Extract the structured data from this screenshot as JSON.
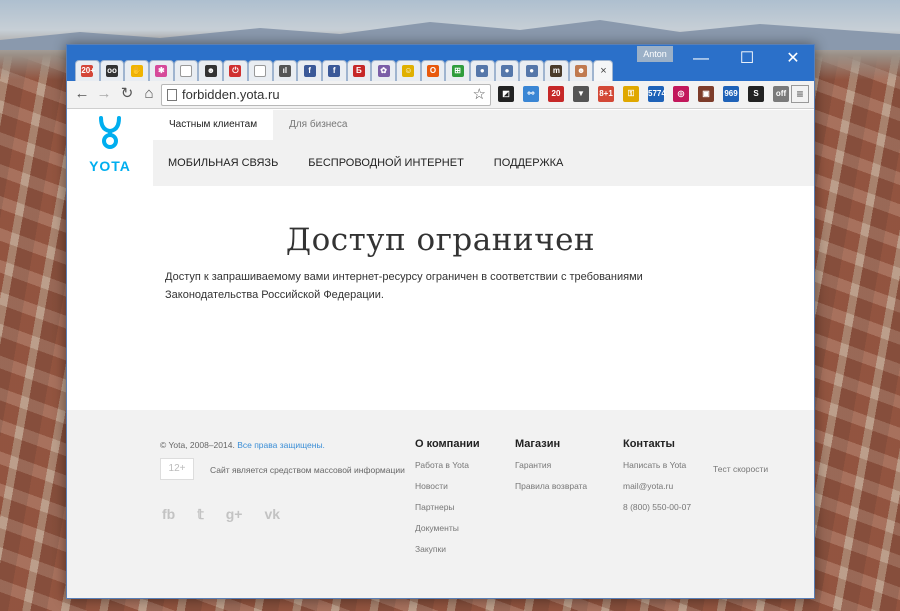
{
  "browser": {
    "profile_name": "Anton",
    "address": "forbidden.yota.ru",
    "window_controls": {
      "minimize": "—",
      "maximize": "☐",
      "close": "✕"
    },
    "active_tab_close": "×",
    "tab_favicons": [
      {
        "icon": "gmail-count-icon",
        "text": "20+",
        "color": "#d44638"
      },
      {
        "icon": "tripadvisor-icon",
        "text": "oo",
        "color": "#333333"
      },
      {
        "icon": "yellow-hand-icon",
        "text": "✋",
        "color": "#f0b400"
      },
      {
        "icon": "colorful-pinwheel-icon",
        "text": "✱",
        "color": "#d64a9a"
      },
      {
        "icon": "blank-page-icon",
        "text": "",
        "color": "#ffffff"
      },
      {
        "icon": "person-avatar-icon",
        "text": "☻",
        "color": "#333333"
      },
      {
        "icon": "power-red-icon",
        "text": "⏻",
        "color": "#d03030"
      },
      {
        "icon": "blank-page-icon",
        "text": "",
        "color": "#ffffff"
      },
      {
        "icon": "chart-bars-icon",
        "text": "ıl",
        "color": "#555555"
      },
      {
        "icon": "facebook-icon",
        "text": "f",
        "color": "#3b5998"
      },
      {
        "icon": "facebook-icon",
        "text": "f",
        "color": "#3b5998"
      },
      {
        "icon": "b-red-letter-icon",
        "text": "Б",
        "color": "#c62828"
      },
      {
        "icon": "purple-puzzle-icon",
        "text": "✿",
        "color": "#7b5ea7"
      },
      {
        "icon": "smiley-yellow-icon",
        "text": "☺",
        "color": "#e0b000"
      },
      {
        "icon": "office-icon",
        "text": "O",
        "color": "#e8590c"
      },
      {
        "icon": "windows-colorful-icon",
        "text": "⊞",
        "color": "#2f9d3c"
      },
      {
        "icon": "user-silhouette-icon",
        "text": "●",
        "color": "#5577aa"
      },
      {
        "icon": "user-silhouette-icon",
        "text": "●",
        "color": "#5577aa"
      },
      {
        "icon": "user-silhouette-icon",
        "text": "●",
        "color": "#5577aa"
      },
      {
        "icon": "m-dark-icon",
        "text": "m",
        "color": "#4a3b2a"
      },
      {
        "icon": "avatar-woman-icon",
        "text": "☻",
        "color": "#c07a50"
      }
    ],
    "extensions": [
      {
        "icon": "stock-chart-icon",
        "text": "◩",
        "color": "#222222"
      },
      {
        "icon": "network-nodes-icon",
        "text": "⚯",
        "color": "#3a86d4"
      },
      {
        "icon": "bell-counter-icon",
        "text": "20",
        "color": "#c62828"
      },
      {
        "icon": "funnel-icon",
        "text": "▼",
        "color": "#555555"
      },
      {
        "icon": "gplus-count-icon",
        "text": "8+1",
        "color": "#d34836"
      },
      {
        "icon": "key-yellow-icon",
        "text": "⚿",
        "color": "#e0a800"
      },
      {
        "icon": "counter-5774-icon",
        "text": "5774",
        "color": "#1e62b8"
      },
      {
        "icon": "target-icon",
        "text": "◎",
        "color": "#c2185b"
      },
      {
        "icon": "image-frame-icon",
        "text": "▣",
        "color": "#7d3c2a"
      },
      {
        "icon": "counter-969-icon",
        "text": "969",
        "color": "#1e62b8"
      },
      {
        "icon": "s-dollar-icon",
        "text": "S",
        "color": "#222222"
      },
      {
        "icon": "toggle-off-icon",
        "text": "off",
        "color": "#7a7a7a"
      }
    ],
    "menu_icon": "≡"
  },
  "site": {
    "logo_text": "YOTA",
    "segments": [
      "Частным клиентам",
      "Для бизнеса"
    ],
    "nav": [
      "МОБИЛЬНАЯ СВЯЗЬ",
      "БЕСПРОВОДНОЙ ИНТЕРНЕТ",
      "ПОДДЕРЖКА"
    ],
    "title": "Доступ ограничен",
    "description": "Доступ к запрашиваемому вами интернет-ресурсу ограничен в соответствии с требованиями Законодательства Российской Федерации.",
    "footer": {
      "copyright": "© Yota, 2008–2014.",
      "rights_link": "Все права защищены.",
      "age_badge": "12+",
      "media_note": "Сайт является средством массовой информации",
      "social": [
        "fb",
        "𝕥",
        "g+",
        "vk"
      ],
      "columns": [
        {
          "heading": "О компании",
          "links": [
            "Работа в Yota",
            "Новости",
            "Партнеры",
            "Документы",
            "Закупки"
          ]
        },
        {
          "heading": "Магазин",
          "links": [
            "Гарантия",
            "Правила возврата"
          ]
        },
        {
          "heading": "Контакты",
          "links": [
            "Написать в Yota",
            "mail@yota.ru",
            "8 (800) 550-00-07"
          ]
        }
      ],
      "speed_test": "Тест скорости"
    }
  },
  "colors": {
    "accent": "#00aeef",
    "titlebar": "#2b70c9",
    "link": "#3b8ed6"
  }
}
